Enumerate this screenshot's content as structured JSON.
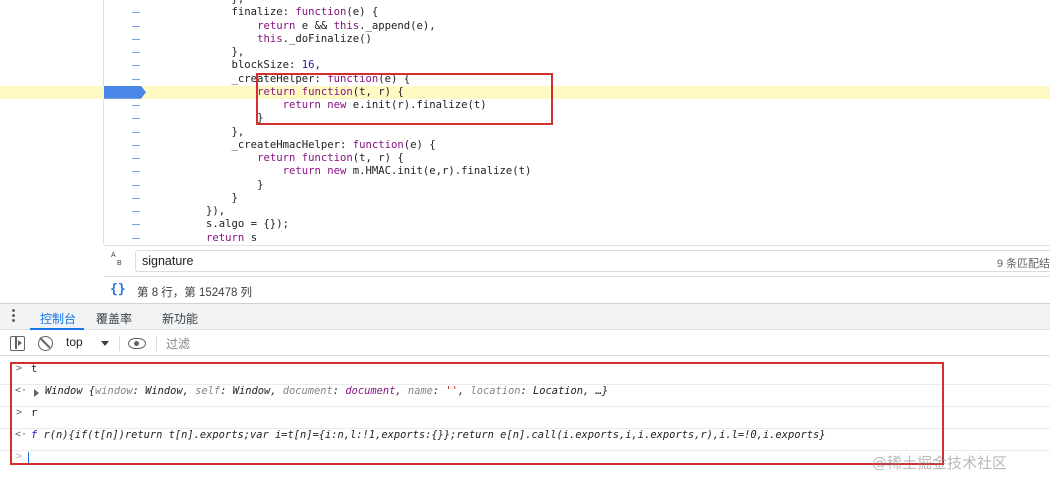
{
  "editor": {
    "lines": [
      {
        "indent": "            ",
        "parts": [
          {
            "t": "},",
            "c": ""
          }
        ]
      },
      {
        "indent": "            ",
        "parts": [
          {
            "t": "finalize: ",
            "c": ""
          },
          {
            "t": "function",
            "c": "kw"
          },
          {
            "t": "(e) {",
            "c": ""
          }
        ]
      },
      {
        "indent": "                ",
        "parts": [
          {
            "t": "return",
            "c": "kw"
          },
          {
            "t": " e && ",
            "c": ""
          },
          {
            "t": "this",
            "c": "kw"
          },
          {
            "t": "._append(e),",
            "c": ""
          }
        ]
      },
      {
        "indent": "                ",
        "parts": [
          {
            "t": "this",
            "c": "kw"
          },
          {
            "t": "._doFinalize()",
            "c": ""
          }
        ]
      },
      {
        "indent": "            ",
        "parts": [
          {
            "t": "},",
            "c": ""
          }
        ]
      },
      {
        "indent": "            ",
        "parts": [
          {
            "t": "blockSize: ",
            "c": ""
          },
          {
            "t": "16",
            "c": "num"
          },
          {
            "t": ",",
            "c": ""
          }
        ]
      },
      {
        "indent": "            ",
        "parts": [
          {
            "t": "_createHelper: ",
            "c": ""
          },
          {
            "t": "function",
            "c": "kw"
          },
          {
            "t": "(e) {",
            "c": ""
          }
        ]
      },
      {
        "indent": "                ",
        "parts": [
          {
            "t": "return",
            "c": "kw"
          },
          {
            "t": " ",
            "c": ""
          },
          {
            "t": "function",
            "c": "kw"
          },
          {
            "t": "(t, r) {",
            "c": ""
          }
        ],
        "active": true
      },
      {
        "indent": "                    ",
        "parts": [
          {
            "t": "return",
            "c": "kw"
          },
          {
            "t": " ",
            "c": ""
          },
          {
            "t": "new",
            "c": "kw"
          },
          {
            "t": " e.init(r).finalize(t)",
            "c": ""
          }
        ]
      },
      {
        "indent": "                ",
        "parts": [
          {
            "t": "}",
            "c": ""
          }
        ]
      },
      {
        "indent": "            ",
        "parts": [
          {
            "t": "},",
            "c": ""
          }
        ]
      },
      {
        "indent": "            ",
        "parts": [
          {
            "t": "_createHmacHelper: ",
            "c": ""
          },
          {
            "t": "function",
            "c": "kw"
          },
          {
            "t": "(e) {",
            "c": ""
          }
        ]
      },
      {
        "indent": "                ",
        "parts": [
          {
            "t": "return",
            "c": "kw"
          },
          {
            "t": " ",
            "c": ""
          },
          {
            "t": "function",
            "c": "kw"
          },
          {
            "t": "(t, r) {",
            "c": ""
          }
        ]
      },
      {
        "indent": "                    ",
        "parts": [
          {
            "t": "return",
            "c": "kw"
          },
          {
            "t": " ",
            "c": ""
          },
          {
            "t": "new",
            "c": "kw"
          },
          {
            "t": " m.HMAC.init(e,r).finalize(t)",
            "c": ""
          }
        ]
      },
      {
        "indent": "                ",
        "parts": [
          {
            "t": "}",
            "c": ""
          }
        ]
      },
      {
        "indent": "            ",
        "parts": [
          {
            "t": "}",
            "c": ""
          }
        ]
      },
      {
        "indent": "        ",
        "parts": [
          {
            "t": "}),",
            "c": ""
          }
        ]
      },
      {
        "indent": "        ",
        "parts": [
          {
            "t": "s.algo = {});",
            "c": ""
          }
        ]
      },
      {
        "indent": "        ",
        "parts": [
          {
            "t": "return",
            "c": "kw"
          },
          {
            "t": " s",
            "c": ""
          }
        ]
      }
    ]
  },
  "search": {
    "case_icon_top": "A",
    "case_icon_bottom": "B",
    "value": "signature",
    "match_count": "9 条匹配结"
  },
  "status": {
    "braces": "{}",
    "cursor_position": "第 8 行，第 152478 列"
  },
  "drawer": {
    "tabs": [
      {
        "label": "控制台",
        "active": true
      },
      {
        "label": "覆盖率",
        "active": false
      },
      {
        "label": "新功能",
        "active": false
      }
    ]
  },
  "console_toolbar": {
    "context": "top",
    "filter_placeholder": "过滤"
  },
  "console": {
    "input_prompt": ">",
    "output_prompt": "<·",
    "entries": [
      {
        "type": "input",
        "text": "t"
      },
      {
        "type": "output-object",
        "parts": [
          {
            "t": "Window {",
            "c": ""
          },
          {
            "t": "window",
            "c": "g"
          },
          {
            "t": ": Window, ",
            "c": ""
          },
          {
            "t": "self",
            "c": "g"
          },
          {
            "t": ": Window, ",
            "c": ""
          },
          {
            "t": "document",
            "c": "g"
          },
          {
            "t": ": ",
            "c": ""
          },
          {
            "t": "document",
            "c": "k"
          },
          {
            "t": ", ",
            "c": ""
          },
          {
            "t": "name",
            "c": "g"
          },
          {
            "t": ": ",
            "c": ""
          },
          {
            "t": "''",
            "c": "s"
          },
          {
            "t": ", ",
            "c": ""
          },
          {
            "t": "location",
            "c": "g"
          },
          {
            "t": ": Location, …}",
            "c": ""
          }
        ]
      },
      {
        "type": "input",
        "text": "r"
      },
      {
        "type": "output-fn",
        "parts": [
          {
            "t": "f",
            "c": "fkw"
          },
          {
            "t": " r(n){if(t[n])return t[n].exports;var i=t[n]={i:n,l:!1,exports:{}};return e[n].call(i.exports,i,i.exports,r),i.l=!0,i.exports}",
            "c": ""
          }
        ]
      }
    ]
  },
  "watermark": "@稀土掘金技术社区",
  "colors": {
    "accent": "#1a73e8",
    "annotation": "#d32f2f",
    "active_line": "#fff9c4",
    "breakpoint": "#4a86e8"
  }
}
